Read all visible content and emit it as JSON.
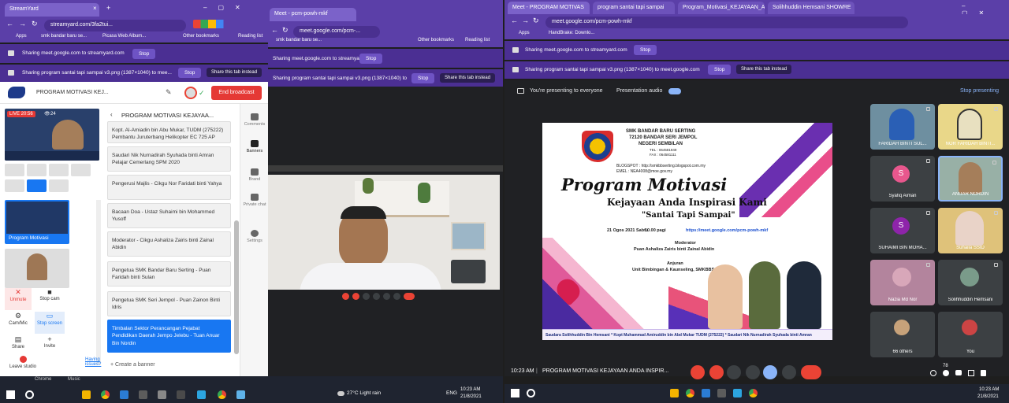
{
  "left": {
    "tabs": [
      {
        "label": "StreamYard"
      },
      {
        "label": "Meet - pcm-powh-mkf"
      }
    ],
    "url": "streamyard.com/3fa2tui...",
    "url2": "meet.google.com/pcm-...",
    "bookmarks": [
      "Apps",
      "smk bandar baru se...",
      "Picasa Web Album...",
      "Other bookmarks",
      "Reading list"
    ],
    "bookmarks2": [
      "smk bandar baru se...",
      "Other bookmarks",
      "Reading list"
    ],
    "sharing1": "Sharing meet.google.com to streamyard.com",
    "sharing2": "Sharing program santai tapi sampai v3.png (1387×1040) to mee...",
    "sharing3": "Sharing program santai tapi sampai v3.png (1387×1040) to meet...",
    "stop": "Stop",
    "share_tab": "Share this tab instead",
    "sy_title": "PROGRAM MOTIVASI KEJ...",
    "end_broadcast": "End broadcast",
    "live_badge": "LIVE 20:56",
    "viewers": "24",
    "program_label": "Program Motivasi",
    "banners_header": "PROGRAM MOTIVASI KEJAYAA...",
    "banners": [
      "Kopt. Al-Amiadin bin Abu Mukar, TUDM (275222) Pembantu Juruterbang Helikopter EC 725 AP",
      "Saudari Nik Nurnadirah Syuhada binti Amran Pelajar Cemerlang SPM 2020",
      "Pengerusi Majlis - Cikgu Nor Faridati binti Yahya",
      "Bacaan Doa - Ustaz Suhaimi bin Mohammed Yusoff",
      "Moderator - Cikgu Ashaliza Zairis binti Zainal Abidin",
      "Pengetua SMK Bandar Baru Serting - Puan Faridah binti Sulan",
      "Pengetua SMK Seri Jempol - Puan Zainon Binti Idris",
      "Timbalan Sektor Perancangan Pejabat Pendidikan Daerah Jempo Jelebu - Tuan Anuar Bin Nordin"
    ],
    "create_banner": "+ Create a banner",
    "rail": [
      "Comments",
      "Banners",
      "Brand",
      "Private chat",
      "Settings"
    ],
    "controls": [
      "Unmute",
      "Stop cam",
      "Cam/Mic",
      "Stop screen",
      "Share",
      "Invite",
      "Leave studio"
    ],
    "having": "Having issues?",
    "task_labels": [
      "Chrome",
      "Music"
    ]
  },
  "middle_taskbar": {
    "weather": "27°C  Light rain",
    "lang": "ENG",
    "time": "10:23 AM",
    "date": "21/8/2021"
  },
  "right": {
    "tabs": [
      "Meet - PROGRAM MOTIVAS",
      "program santai tapi sampai",
      "Program_Motivasi_KEJAYAAN_A",
      "Solihhuddin Hemsani SHOWRE"
    ],
    "url": "meet.google.com/pcm-powh-mkf",
    "bookmarks": [
      "Apps",
      "HandBrake: Downlo..."
    ],
    "sharing1": "Sharing meet.google.com to streamyard.com",
    "sharing2": "Sharing program santai tapi sampai v3.png (1387×1040) to meet.google.com",
    "presenting": "You're presenting to everyone",
    "presentation_audio": "Presentation audio",
    "stop_presenting": "Stop presenting",
    "poster": {
      "school": "SMK BANDAR BARU SERTING",
      "address1": "72120 BANDAR SERI JEMPOL",
      "address2": "NEGERI SEMBILAN",
      "tel": "TEL : 064581949",
      "fax": "FAX : 064581111",
      "blog": "BLOGSPOT : http://smkbbserting.blogspot.com.my",
      "email": "EMEL : NEA4008@moe.gov.my",
      "title": "Program Motivasi",
      "subtitle": "Kejayaan Anda Inspirasi Kami",
      "tagline": "\"Santai Tapi Sampai\"",
      "date": "21 Ogos 2021 Sabtu",
      "time": "10.00 pagi",
      "link": "https://meet.google.com/pcm-powh-mkf",
      "moderator_label": "Moderator",
      "moderator": "Puan Ashaliza Zairis binti Zainal Abidin",
      "anjuran_label": "Anjuran",
      "anjuran": "Unit Bimbingan & Kaunseling, SMKBBS",
      "ticker": "Saudara Solihhuddin Bin Hemsani  *  Kopt Muhammad Amiruddin bin Abd Mukar TUDM (275222)  *  Saudari Nik Nurnadirah Syuhada binti Amran"
    },
    "participants": [
      "FARIDAH BINTI SUL...",
      "NOR FARIDAH BINTI...",
      "Syafiq Aiman",
      "ANUAR NORDIN",
      "SUHAIMI BIN MOHA...",
      "Suhaila SSID",
      "Nazia Md Nor",
      "Solihhuddin Hemsani",
      "66 others",
      "You"
    ],
    "meeting_time": "10:23 AM",
    "meeting_name": "PROGRAM MOTIVASI KEJAYAAN ANDA INSPIR...",
    "count": "78",
    "task_time": "10:23 AM",
    "task_date": "21/8/2021"
  }
}
